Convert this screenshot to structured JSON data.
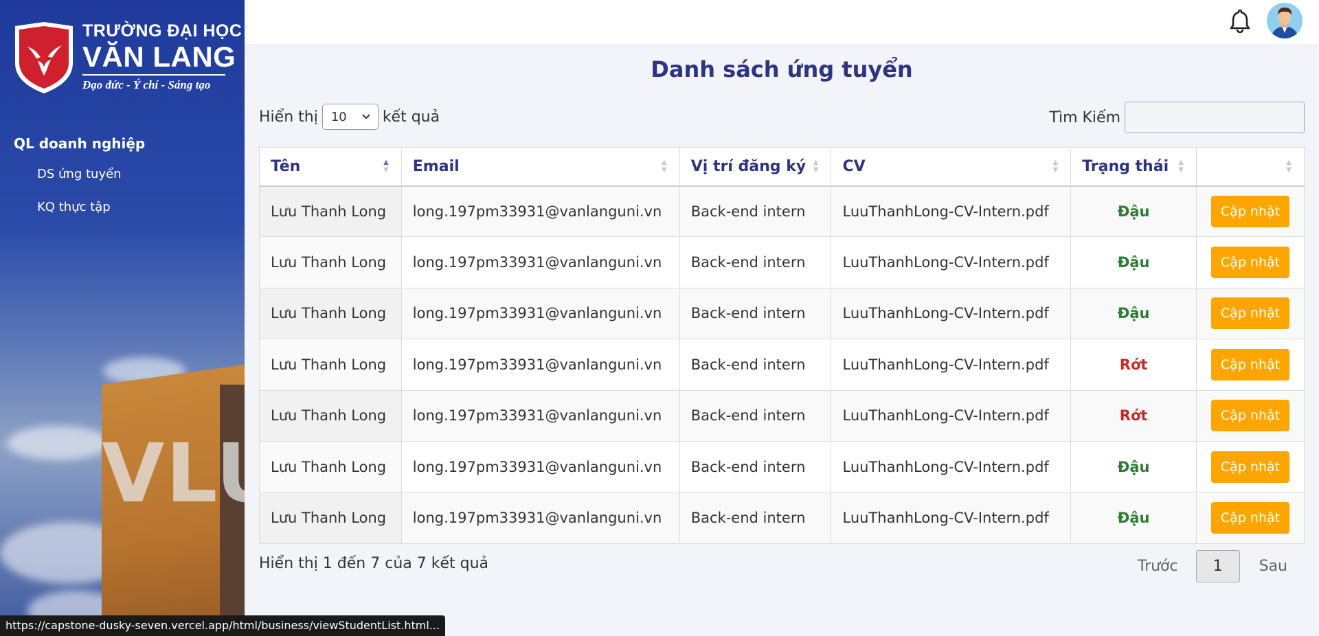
{
  "sidebar": {
    "logo": {
      "line1": "TRƯỜNG ĐẠI HỌC",
      "line2": "VĂN LANG",
      "motto": "Đạo đức - Ý chí - Sáng tạo",
      "building_sign": "VLU"
    },
    "section_title": "QL doanh nghiệp",
    "items": [
      {
        "label": "DS ứng tuyển"
      },
      {
        "label": "KQ thực tập"
      }
    ]
  },
  "header": {
    "icons": [
      "bell-icon",
      "user-avatar"
    ]
  },
  "main": {
    "title": "Danh sách ứng tuyển",
    "length": {
      "prefix": "Hiển thị",
      "value": "10",
      "suffix": "kết quả"
    },
    "search": {
      "label": "Tìm Kiếm",
      "value": ""
    },
    "table": {
      "columns": [
        "Tên",
        "Email",
        "Vị trí đăng ký",
        "CV",
        "Trạng thái",
        ""
      ],
      "rows": [
        {
          "name": "Lưu Thanh Long",
          "email": "long.197pm33931@vanlanguni.vn",
          "position": "Back-end intern",
          "cv": "LuuThanhLong-CV-Intern.pdf",
          "status": "Đậu",
          "action": "Cập nhật"
        },
        {
          "name": "Lưu Thanh Long",
          "email": "long.197pm33931@vanlanguni.vn",
          "position": "Back-end intern",
          "cv": "LuuThanhLong-CV-Intern.pdf",
          "status": "Đậu",
          "action": "Cập nhật"
        },
        {
          "name": "Lưu Thanh Long",
          "email": "long.197pm33931@vanlanguni.vn",
          "position": "Back-end intern",
          "cv": "LuuThanhLong-CV-Intern.pdf",
          "status": "Đậu",
          "action": "Cập nhật"
        },
        {
          "name": "Lưu Thanh Long",
          "email": "long.197pm33931@vanlanguni.vn",
          "position": "Back-end intern",
          "cv": "LuuThanhLong-CV-Intern.pdf",
          "status": "Rớt",
          "action": "Cập nhật"
        },
        {
          "name": "Lưu Thanh Long",
          "email": "long.197pm33931@vanlanguni.vn",
          "position": "Back-end intern",
          "cv": "LuuThanhLong-CV-Intern.pdf",
          "status": "Rớt",
          "action": "Cập nhật"
        },
        {
          "name": "Lưu Thanh Long",
          "email": "long.197pm33931@vanlanguni.vn",
          "position": "Back-end intern",
          "cv": "LuuThanhLong-CV-Intern.pdf",
          "status": "Đậu",
          "action": "Cập nhật"
        },
        {
          "name": "Lưu Thanh Long",
          "email": "long.197pm33931@vanlanguni.vn",
          "position": "Back-end intern",
          "cv": "LuuThanhLong-CV-Intern.pdf",
          "status": "Đậu",
          "action": "Cập nhật"
        }
      ]
    },
    "info": "Hiển thị 1 đến 7 của 7 kết quả",
    "pagination": {
      "prev": "Trước",
      "current": "1",
      "next": "Sau"
    }
  },
  "statusbar": {
    "url": "https://capstone-dusky-seven.vercel.app/html/business/viewStudentList.html..."
  },
  "colors": {
    "primary": "#2e3383",
    "sidebar": "#1f3a9c",
    "button": "#ffa500",
    "pass": "#2e7d32",
    "fail": "#c62828"
  }
}
